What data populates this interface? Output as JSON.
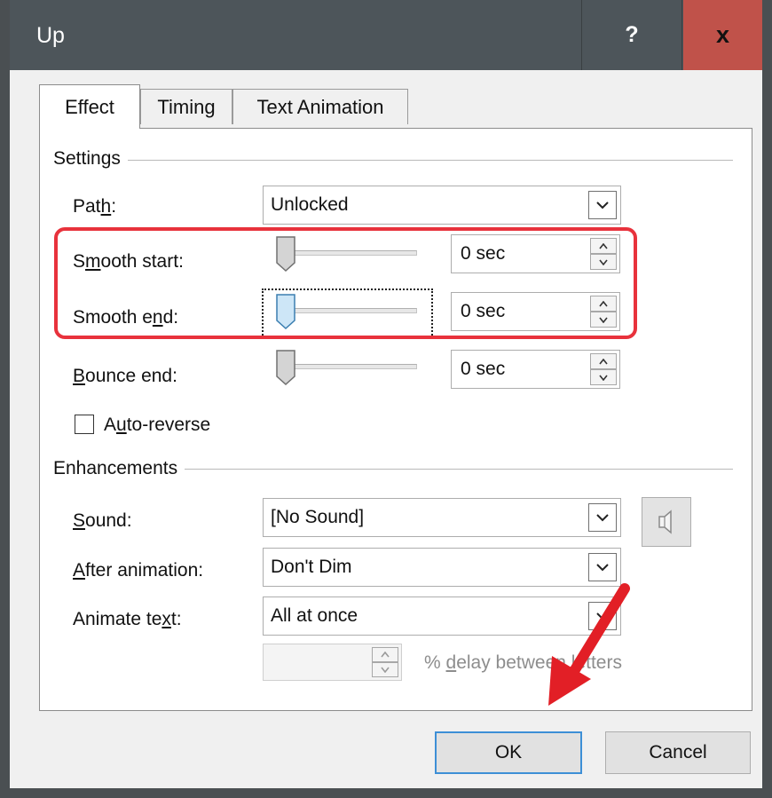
{
  "window": {
    "title": "Up",
    "help_label": "?",
    "close_label": "x"
  },
  "tabs": [
    {
      "label": "Effect",
      "selected": true
    },
    {
      "label": "Timing",
      "selected": false
    },
    {
      "label": "Text Animation",
      "selected": false
    }
  ],
  "settings": {
    "group_label": "Settings",
    "path": {
      "label_pre": "Pat",
      "label_key": "h",
      "label_post": ":",
      "value": "Unlocked"
    },
    "smooth_start": {
      "label_pre": "S",
      "label_key": "m",
      "label_post": "ooth start:",
      "value": "0 sec"
    },
    "smooth_end": {
      "label_pre": "Smooth e",
      "label_key": "n",
      "label_post": "d:",
      "value": "0 sec"
    },
    "bounce_end": {
      "label_pre": "",
      "label_key": "B",
      "label_post": "ounce end:",
      "value": "0 sec"
    },
    "auto_reverse": {
      "label_pre": "A",
      "label_key": "u",
      "label_post": "to-reverse",
      "checked": false
    }
  },
  "enhancements": {
    "group_label": "Enhancements",
    "sound": {
      "label_pre": "",
      "label_key": "S",
      "label_post": "ound:",
      "value": "[No Sound]"
    },
    "after_animation": {
      "label_pre": "",
      "label_key": "A",
      "label_post": "fter animation:",
      "value": "Don't Dim"
    },
    "animate_text": {
      "label_pre": "Animate te",
      "label_key": "x",
      "label_post": "t:",
      "value": "All at once"
    },
    "delay": {
      "value": "",
      "suffix_pre": "% ",
      "suffix_key": "d",
      "suffix_post": "elay between letters"
    }
  },
  "buttons": {
    "ok": "OK",
    "cancel": "Cancel"
  },
  "colors": {
    "highlight": "#e8323c",
    "arrow": "#e21f26",
    "close": "#c0524a",
    "titlebar": "#4d555a"
  }
}
